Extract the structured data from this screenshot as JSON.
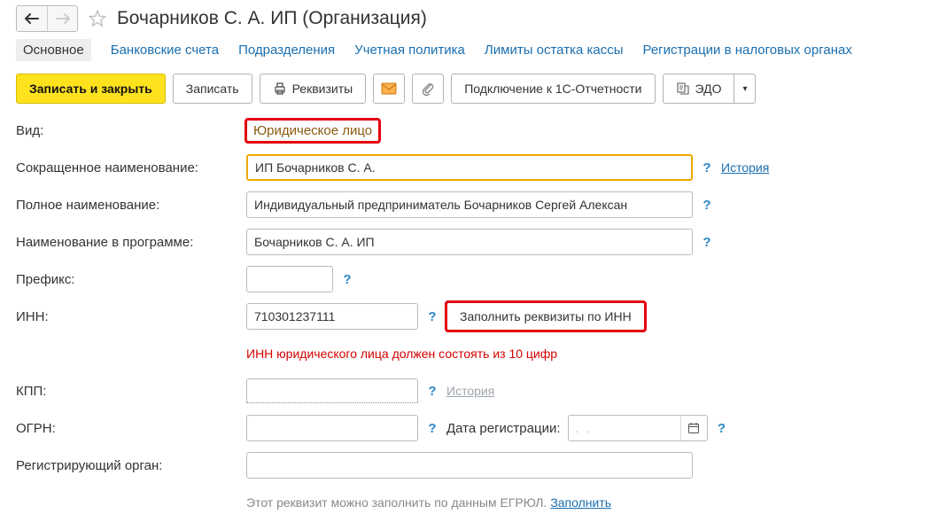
{
  "header": {
    "title": "Бочарников С. А. ИП (Организация)"
  },
  "tabs": {
    "main": "Основное",
    "bank_accounts": "Банковские счета",
    "departments": "Подразделения",
    "accounting_policy": "Учетная политика",
    "cash_limits": "Лимиты остатка кассы",
    "tax_registrations": "Регистрации в налоговых органах"
  },
  "toolbar": {
    "save_close": "Записать и закрыть",
    "save": "Записать",
    "requisites": "Реквизиты",
    "connect_1c": "Подключение к 1С-Отчетности",
    "edo": "ЭДО"
  },
  "form": {
    "type_label": "Вид:",
    "type_value": "Юридическое лицо",
    "short_name_label": "Сокращенное наименование:",
    "short_name_value": "ИП Бочарников С. А.",
    "history_link": "История",
    "full_name_label": "Полное наименование:",
    "full_name_value": "Индивидуальный предприниматель Бочарников Сергей Алексан",
    "program_name_label": "Наименование в программе:",
    "program_name_value": "Бочарников С. А. ИП",
    "prefix_label": "Префикс:",
    "prefix_value": "",
    "inn_label": "ИНН:",
    "inn_value": "710301237111",
    "fill_by_inn": "Заполнить реквизиты по ИНН",
    "inn_error": "ИНН юридического лица должен состоять из 10 цифр",
    "kpp_label": "КПП:",
    "kpp_value": "",
    "ogrn_label": "ОГРН:",
    "ogrn_value": "",
    "reg_date_label": "Дата регистрации:",
    "reg_date_value": "  .  .    ",
    "reg_authority_label": "Регистрирующий орган:",
    "reg_authority_value": "",
    "reg_hint": "Этот реквизит можно заполнить по данным ЕГРЮЛ. ",
    "fill_link": "Заполнить"
  }
}
